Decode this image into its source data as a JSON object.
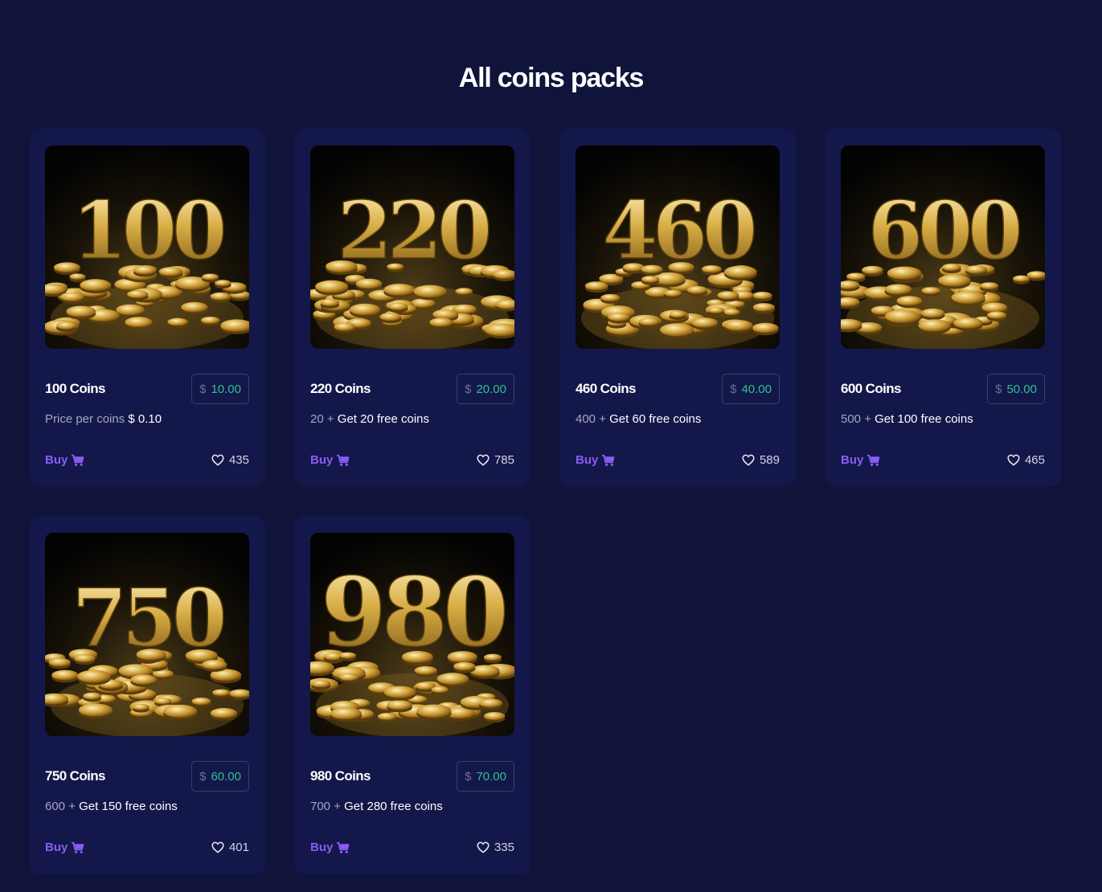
{
  "header": {
    "title": "All coins packs"
  },
  "colors": {
    "background": "#10133a",
    "card": "#14174a",
    "accent": "#8a5cf6",
    "price": "#2ec28a",
    "gold": "#d8ad45"
  },
  "packs": [
    {
      "image_number": "100",
      "name": "100 Coins",
      "currency": "$",
      "price": "10.00",
      "desc_prefix": "Price per coins",
      "desc_value": "$ 0.10",
      "buy_label": "Buy",
      "buy_icon": "cart-icon",
      "likes": "435",
      "like_icon": "heart-icon"
    },
    {
      "image_number": "220",
      "name": "220 Coins",
      "currency": "$",
      "price": "20.00",
      "desc_prefix": "20 +",
      "desc_value": "Get 20 free coins",
      "buy_label": "Buy",
      "buy_icon": "cart-icon",
      "likes": "785",
      "like_icon": "heart-icon"
    },
    {
      "image_number": "460",
      "name": "460 Coins",
      "currency": "$",
      "price": "40.00",
      "desc_prefix": "400 +",
      "desc_value": "Get 60 free coins",
      "buy_label": "Buy",
      "buy_icon": "cart-icon",
      "likes": "589",
      "like_icon": "heart-icon"
    },
    {
      "image_number": "600",
      "name": "600 Coins",
      "currency": "$",
      "price": "50.00",
      "desc_prefix": "500 +",
      "desc_value": "Get 100 free coins",
      "buy_label": "Buy",
      "buy_icon": "cart-icon",
      "likes": "465",
      "like_icon": "heart-icon"
    },
    {
      "image_number": "750",
      "name": "750 Coins",
      "currency": "$",
      "price": "60.00",
      "desc_prefix": "600 +",
      "desc_value": "Get 150 free coins",
      "buy_label": "Buy",
      "buy_icon": "cart-icon",
      "likes": "401",
      "like_icon": "heart-icon"
    },
    {
      "image_number": "980",
      "name": "980 Coins",
      "currency": "$",
      "price": "70.00",
      "desc_prefix": "700 +",
      "desc_value": "Get 280 free coins",
      "buy_label": "Buy",
      "buy_icon": "cart-icon",
      "likes": "335",
      "like_icon": "heart-icon"
    }
  ]
}
